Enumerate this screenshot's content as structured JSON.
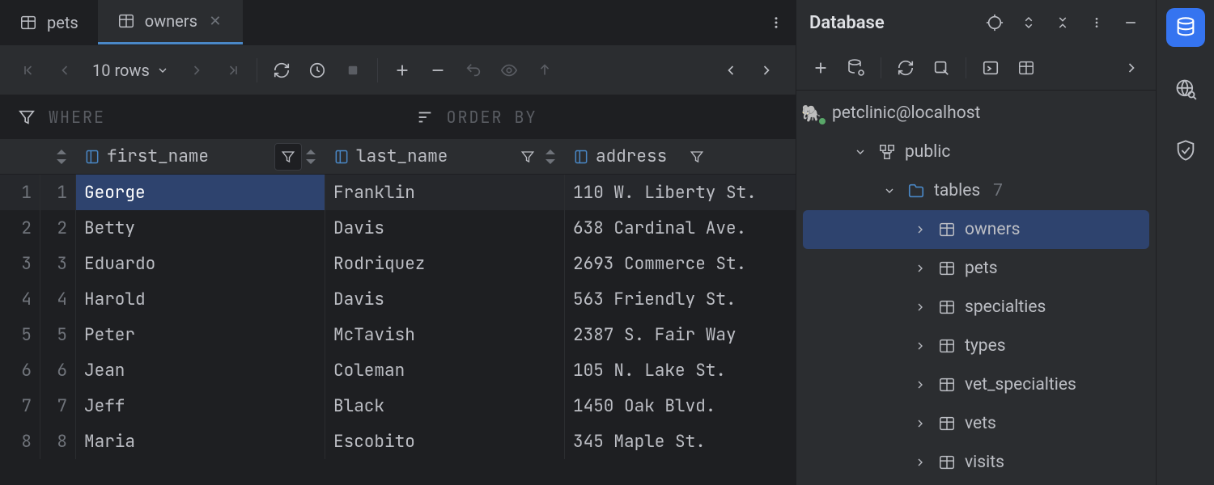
{
  "tabs": {
    "items": [
      {
        "label": "pets",
        "active": false,
        "closable": false
      },
      {
        "label": "owners",
        "active": true,
        "closable": true
      }
    ]
  },
  "toolbar": {
    "rows_label": "10 rows"
  },
  "filters": {
    "where_label": "WHERE",
    "order_label": "ORDER BY"
  },
  "columns": {
    "first_name": "first_name",
    "last_name": "last_name",
    "address": "address"
  },
  "rows": [
    {
      "n": 1,
      "first_name": "George",
      "last_name": "Franklin",
      "address": "110 W. Liberty St."
    },
    {
      "n": 2,
      "first_name": "Betty",
      "last_name": "Davis",
      "address": "638 Cardinal Ave."
    },
    {
      "n": 3,
      "first_name": "Eduardo",
      "last_name": "Rodriquez",
      "address": "2693 Commerce St."
    },
    {
      "n": 4,
      "first_name": "Harold",
      "last_name": "Davis",
      "address": "563 Friendly St."
    },
    {
      "n": 5,
      "first_name": "Peter",
      "last_name": "McTavish",
      "address": "2387 S. Fair Way"
    },
    {
      "n": 6,
      "first_name": "Jean",
      "last_name": "Coleman",
      "address": "105 N. Lake St."
    },
    {
      "n": 7,
      "first_name": "Jeff",
      "last_name": "Black",
      "address": "1450 Oak Blvd."
    },
    {
      "n": 8,
      "first_name": "Maria",
      "last_name": "Escobito",
      "address": "345 Maple St."
    }
  ],
  "db_panel": {
    "title": "Database",
    "datasource": "petclinic@localhost",
    "schema": "public",
    "tables_label": "tables",
    "tables_count": "7",
    "tables": [
      {
        "name": "owners",
        "selected": true
      },
      {
        "name": "pets",
        "selected": false
      },
      {
        "name": "specialties",
        "selected": false
      },
      {
        "name": "types",
        "selected": false
      },
      {
        "name": "vet_specialties",
        "selected": false
      },
      {
        "name": "vets",
        "selected": false
      },
      {
        "name": "visits",
        "selected": false
      }
    ]
  }
}
